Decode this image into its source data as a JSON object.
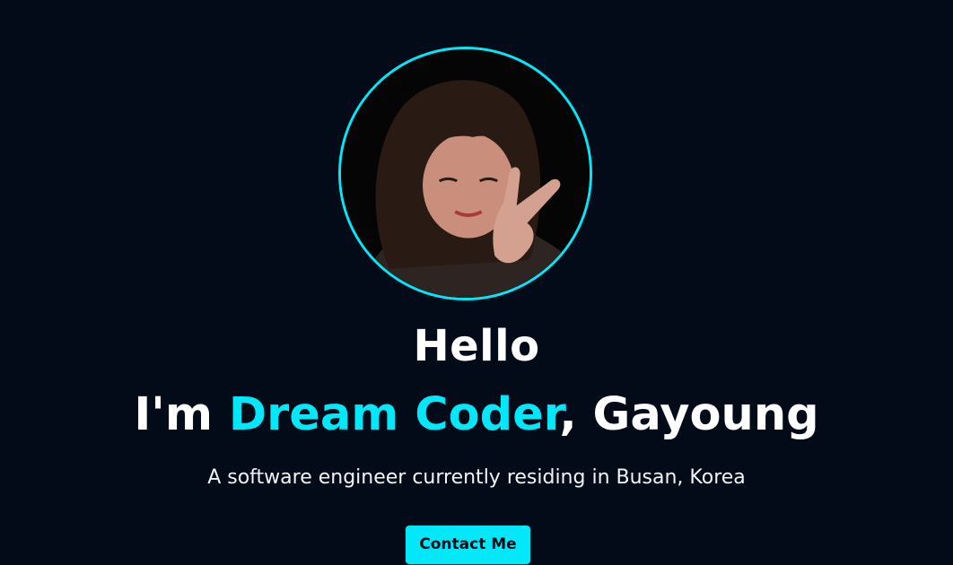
{
  "home": {
    "greeting": "Hello",
    "intro": {
      "prefix": "I'm ",
      "highlight": "Dream Coder",
      "suffix": ", Gayoung"
    },
    "description": "A software engineer currently residing in Busan, Korea",
    "contact_label": "Contact Me",
    "avatar_alt": "profile photo"
  },
  "colors": {
    "background": "#030a18",
    "accent": "#03e8f9",
    "text": "#ffffff"
  }
}
